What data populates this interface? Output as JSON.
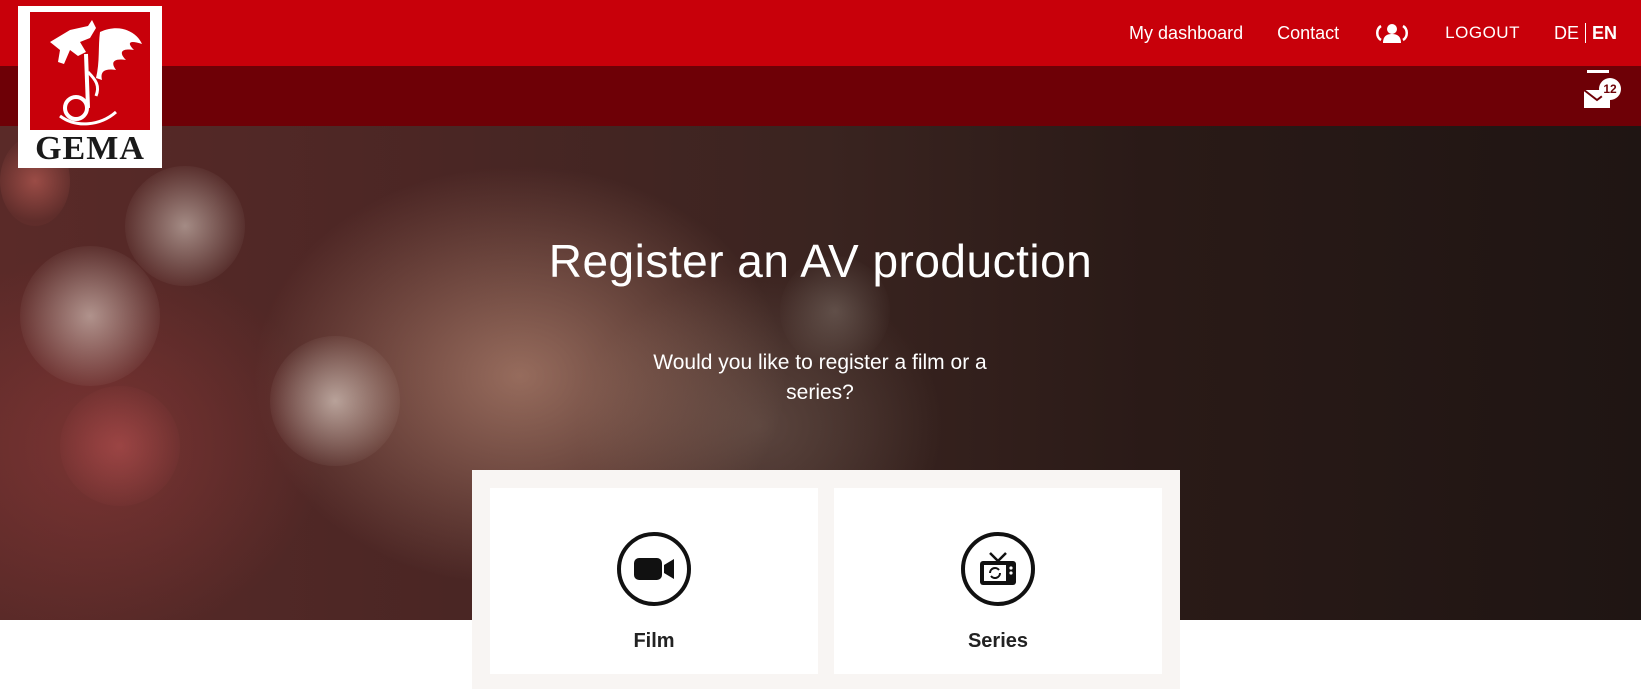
{
  "logo": {
    "text": "GEMA"
  },
  "nav": {
    "dashboard": "My dashboard",
    "contact": "Contact",
    "account_icon": "user-group-icon",
    "logout": "LOGOUT",
    "lang_de": "DE",
    "lang_en": "EN",
    "active_lang": "EN"
  },
  "notifications": {
    "icon": "mail-icon",
    "count": "12"
  },
  "hero": {
    "title": "Register an AV production",
    "subtitle": "Would you like to register a film or a series?"
  },
  "options": [
    {
      "label": "Film",
      "icon": "video-camera-icon"
    },
    {
      "label": "Series",
      "icon": "tv-icon"
    }
  ],
  "colors": {
    "brand_red": "#c8000a",
    "dark_red": "#6e0006"
  }
}
